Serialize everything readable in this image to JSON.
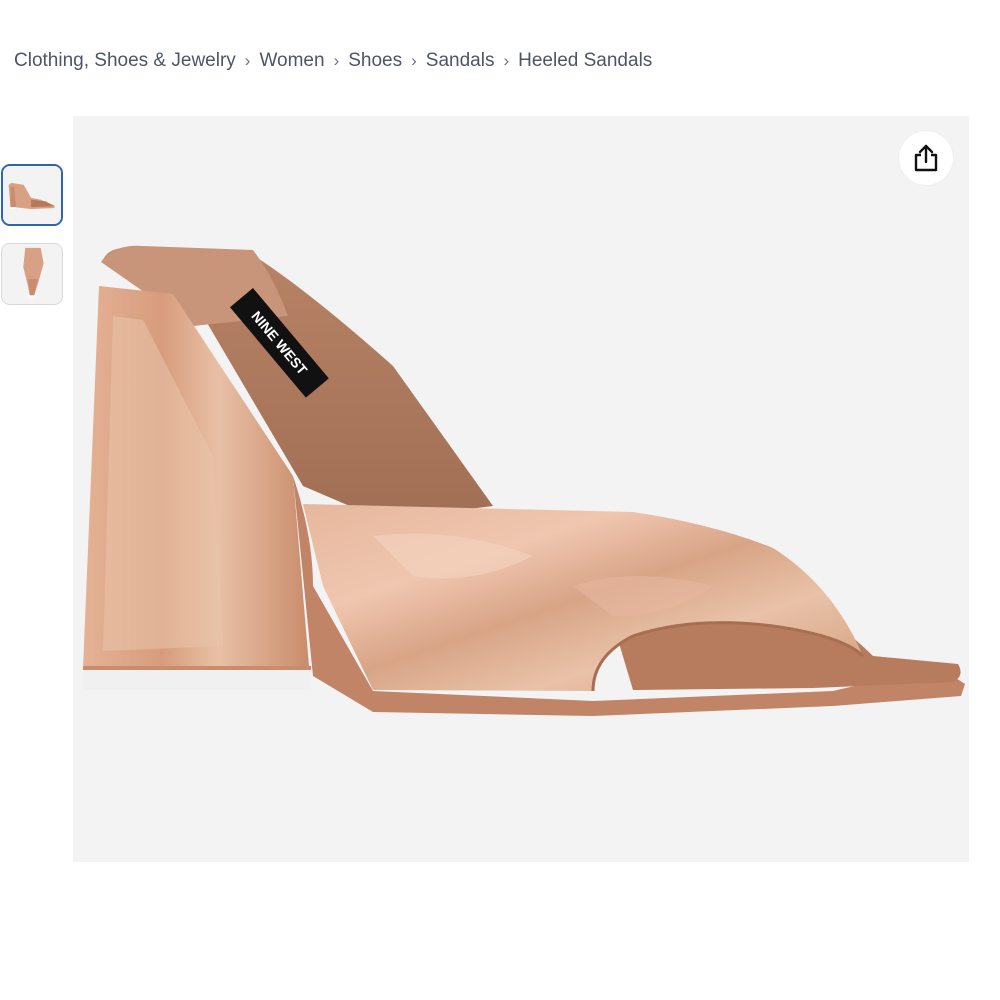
{
  "breadcrumb": {
    "items": [
      {
        "label": "Clothing, Shoes & Jewelry"
      },
      {
        "label": "Women"
      },
      {
        "label": "Shoes"
      },
      {
        "label": "Sandals"
      },
      {
        "label": "Heeled Sandals"
      }
    ],
    "separator": "›"
  },
  "gallery": {
    "thumbnails": [
      {
        "icon": "shoe-side-thumbnail",
        "selected": true
      },
      {
        "icon": "shoe-top-thumbnail",
        "selected": false
      }
    ],
    "main_image": {
      "icon": "heeled-sandal-image",
      "brand_label": "NINE WEST"
    }
  },
  "share": {
    "icon": "share-icon"
  },
  "colors": {
    "selected_border": "#2f64b1",
    "breadcrumb_text": "#4d5566",
    "image_background": "#f3f3f3"
  }
}
